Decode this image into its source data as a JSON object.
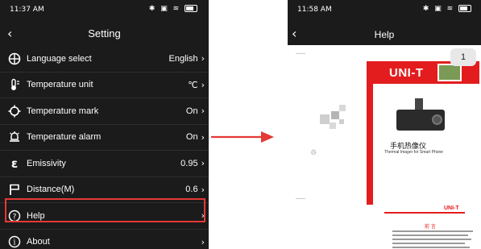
{
  "left_screen": {
    "status": {
      "time": "11:37 AM",
      "icons": "✱ ▣ ≋"
    },
    "nav": {
      "back_icon": "‹",
      "title": "Setting"
    },
    "rows": [
      {
        "icon": "globe-icon",
        "glyph": "⊕",
        "label": "Language select",
        "value": "English",
        "chevron": "›"
      },
      {
        "icon": "thermometer-icon",
        "glyph": "🌡",
        "label": "Temperature unit",
        "value": "℃",
        "chevron": "›"
      },
      {
        "icon": "crosshair-icon",
        "glyph": "⌖",
        "label": "Temperature mark",
        "value": "On",
        "chevron": "›"
      },
      {
        "icon": "alarm-icon",
        "glyph": "♖",
        "label": "Temperature alarm",
        "value": "On",
        "chevron": "›"
      },
      {
        "icon": "epsilon-icon",
        "glyph": "ε",
        "label": "Emissivity",
        "value": "0.95",
        "chevron": "›"
      },
      {
        "icon": "flag-icon",
        "glyph": "⚐",
        "label": "Distance(M)",
        "value": "0.6",
        "chevron": "›"
      },
      {
        "icon": "help-icon",
        "glyph": "?",
        "label": "Help",
        "value": "",
        "chevron": "›"
      },
      {
        "icon": "info-icon",
        "glyph": "i",
        "label": "About",
        "value": "",
        "chevron": "›"
      }
    ],
    "highlighted_row": "Help",
    "highlight_color": "#e53935"
  },
  "arrow_color": "#e53935",
  "right_screen": {
    "status": {
      "time": "11:58 AM",
      "icons": "✱ ▣ ≋"
    },
    "nav": {
      "back_icon": "‹",
      "title": "Help"
    },
    "page_badge": "1",
    "document": {
      "brand": "UNI-T",
      "product_title_cn": "手机热像仪",
      "product_title_en": "Thermal Imager for Smart Phone",
      "second_page_brand": "UNI-T",
      "second_page_heading": "前 言"
    }
  }
}
